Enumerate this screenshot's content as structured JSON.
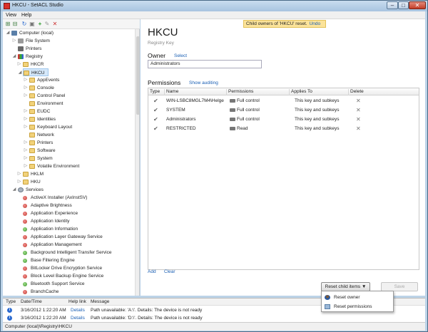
{
  "window": {
    "title": "HKCU - SetACL Studio"
  },
  "menu": [
    "View",
    "Help"
  ],
  "tree": {
    "items": [
      {
        "label": "Computer (local)",
        "level": 0,
        "icon": "computer-icon",
        "exp": "◢"
      },
      {
        "label": "File System",
        "level": 1,
        "icon": "drive-icon",
        "exp": "▷"
      },
      {
        "label": "Printers",
        "level": 1,
        "icon": "printer-icon",
        "exp": ""
      },
      {
        "label": "Registry",
        "level": 1,
        "icon": "registry-icon",
        "exp": "◢"
      },
      {
        "label": "HKCR",
        "level": 2,
        "icon": "folder-icon",
        "exp": "▷"
      },
      {
        "label": "HKCU",
        "level": 2,
        "icon": "folder-icon",
        "exp": "◢",
        "selected": true
      },
      {
        "label": "AppEvents",
        "level": 3,
        "icon": "folder-icon",
        "exp": "▷"
      },
      {
        "label": "Console",
        "level": 3,
        "icon": "folder-icon",
        "exp": "▷"
      },
      {
        "label": "Control Panel",
        "level": 3,
        "icon": "folder-icon",
        "exp": "▷"
      },
      {
        "label": "Environment",
        "level": 3,
        "icon": "folder-icon",
        "exp": ""
      },
      {
        "label": "EUDC",
        "level": 3,
        "icon": "folder-icon",
        "exp": "▷"
      },
      {
        "label": "Identities",
        "level": 3,
        "icon": "folder-icon",
        "exp": "▷"
      },
      {
        "label": "Keyboard Layout",
        "level": 3,
        "icon": "folder-icon",
        "exp": "▷"
      },
      {
        "label": "Network",
        "level": 3,
        "icon": "folder-icon",
        "exp": ""
      },
      {
        "label": "Printers",
        "level": 3,
        "icon": "folder-icon",
        "exp": "▷"
      },
      {
        "label": "Software",
        "level": 3,
        "icon": "folder-icon",
        "exp": "▷"
      },
      {
        "label": "System",
        "level": 3,
        "icon": "folder-icon",
        "exp": "▷"
      },
      {
        "label": "Volatile Environment",
        "level": 3,
        "icon": "folder-icon",
        "exp": "▷"
      },
      {
        "label": "HKLM",
        "level": 2,
        "icon": "folder-icon",
        "exp": "▷"
      },
      {
        "label": "HKU",
        "level": 2,
        "icon": "folder-icon",
        "exp": "▷"
      },
      {
        "label": "Services",
        "level": 1,
        "icon": "gear-icon",
        "exp": "◢"
      },
      {
        "label": "ActiveX Installer (AxInstSV)",
        "level": 2,
        "icon": "service-stopped-icon",
        "exp": ""
      },
      {
        "label": "Adaptive Brightness",
        "level": 2,
        "icon": "service-stopped-icon",
        "exp": ""
      },
      {
        "label": "Application Experience",
        "level": 2,
        "icon": "service-stopped-icon",
        "exp": ""
      },
      {
        "label": "Application Identity",
        "level": 2,
        "icon": "service-stopped-icon",
        "exp": ""
      },
      {
        "label": "Application Information",
        "level": 2,
        "icon": "service-running-icon",
        "exp": ""
      },
      {
        "label": "Application Layer Gateway Service",
        "level": 2,
        "icon": "service-stopped-icon",
        "exp": ""
      },
      {
        "label": "Application Management",
        "level": 2,
        "icon": "service-stopped-icon",
        "exp": ""
      },
      {
        "label": "Background Intelligent Transfer Service",
        "level": 2,
        "icon": "service-running-icon",
        "exp": ""
      },
      {
        "label": "Base Filtering Engine",
        "level": 2,
        "icon": "service-running-icon",
        "exp": ""
      },
      {
        "label": "BitLocker Drive Encryption Service",
        "level": 2,
        "icon": "service-stopped-icon",
        "exp": ""
      },
      {
        "label": "Block Level Backup Engine Service",
        "level": 2,
        "icon": "service-stopped-icon",
        "exp": ""
      },
      {
        "label": "Bluetooth Support Service",
        "level": 2,
        "icon": "service-running-icon",
        "exp": ""
      },
      {
        "label": "BranchCache",
        "level": 2,
        "icon": "service-stopped-icon",
        "exp": ""
      }
    ]
  },
  "notify": {
    "text": "Child owners of 'HKCU' reset.",
    "undo": "Undo"
  },
  "header": {
    "title": "HKCU",
    "subtitle": "Registry Key"
  },
  "owner": {
    "label": "Owner",
    "select_link": "Select",
    "value": "Administrators"
  },
  "permissions": {
    "label": "Permissions",
    "show_auditing_link": "Show auditing",
    "columns": [
      "Type",
      "Name",
      "Permissions",
      "Applies To",
      "Delete"
    ],
    "rows": [
      {
        "name": "WIN-LSBC8MGL7M4\\Helge",
        "perm": "Full control",
        "applies": "This key and subkeys"
      },
      {
        "name": "SYSTEM",
        "perm": "Full control",
        "applies": "This key and subkeys"
      },
      {
        "name": "Administrators",
        "perm": "Full control",
        "applies": "This key and subkeys"
      },
      {
        "name": "RESTRICTED",
        "perm": "Read",
        "applies": "This key and subkeys"
      }
    ],
    "add_link": "Add",
    "clear_link": "Clear"
  },
  "actions": {
    "reset_child_items": "Reset child items",
    "save": "Save",
    "popup": [
      "Reset owner",
      "Reset permissions"
    ]
  },
  "log": {
    "columns": [
      "Type",
      "Date/Time",
      "Help link",
      "Message"
    ],
    "rows": [
      {
        "datetime": "3/16/2012 1:22:20 AM",
        "help": "Details",
        "message": "Path unavailable: 'A:\\'. Details: The device is not ready"
      },
      {
        "datetime": "3/16/2012 1:22:20 AM",
        "help": "Details",
        "message": "Path unavailable: 'D:\\'. Details: The device is not ready"
      }
    ]
  },
  "status": {
    "path": "Computer (local)\\Registry\\HKCU"
  },
  "colors": {
    "accent": "#1a5fb4",
    "notify_bg": "#fbe39a",
    "selection": "#d5e8fa"
  }
}
